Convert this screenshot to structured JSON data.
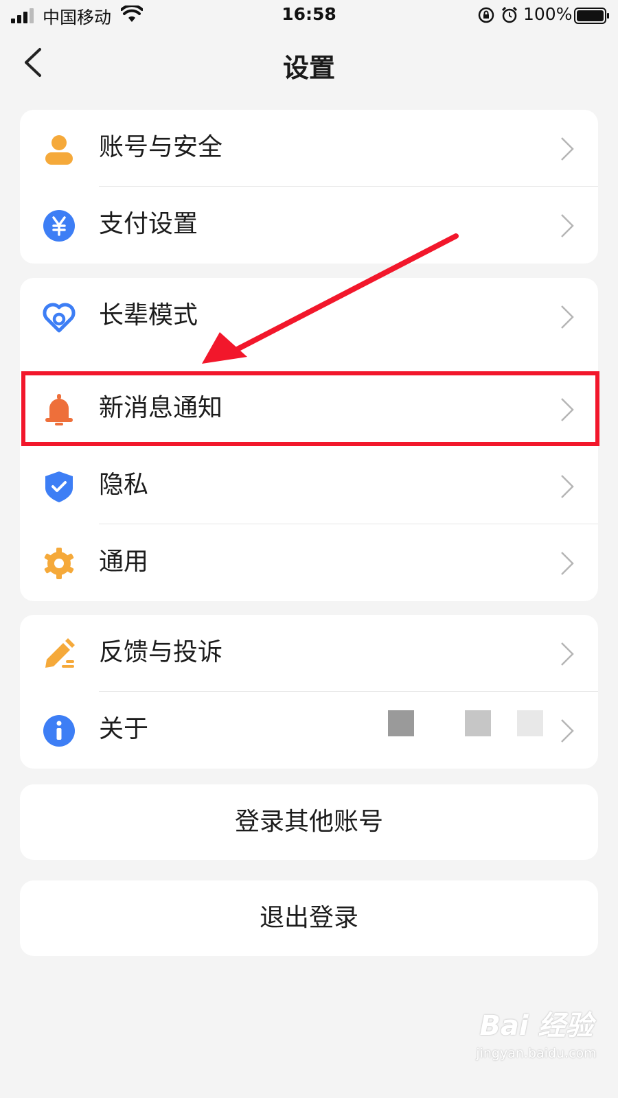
{
  "status_bar": {
    "carrier": "中国移动",
    "time": "16:58",
    "battery": "100%"
  },
  "nav": {
    "title": "设置"
  },
  "groups": [
    {
      "items": [
        {
          "label": "账号与安全",
          "icon": "user-icon",
          "icon_color": "#f5a93a"
        },
        {
          "label": "支付设置",
          "icon": "yuan-icon",
          "icon_color": "#3d7ef5"
        }
      ]
    },
    {
      "items": [
        {
          "label": "长辈模式",
          "icon": "heart-icon",
          "icon_color": "#3d7ef5"
        },
        {
          "label": "新消息通知",
          "icon": "bell-icon",
          "icon_color": "#ee6f3a"
        },
        {
          "label": "隐私",
          "icon": "shield-icon",
          "icon_color": "#3d7ef5"
        },
        {
          "label": "通用",
          "icon": "gear-icon",
          "icon_color": "#f5a93a"
        }
      ]
    },
    {
      "items": [
        {
          "label": "反馈与投诉",
          "icon": "pencil-icon",
          "icon_color": "#f5a93a"
        },
        {
          "label": "关于",
          "icon": "info-icon",
          "icon_color": "#3d7ef5"
        }
      ]
    }
  ],
  "actions": {
    "switch_account": "登录其他账号",
    "logout": "退出登录"
  },
  "annotation": {
    "highlight_color": "#f2172b"
  },
  "watermark": {
    "logo": "Bai 经验",
    "site": "jingyan.baidu.com"
  }
}
